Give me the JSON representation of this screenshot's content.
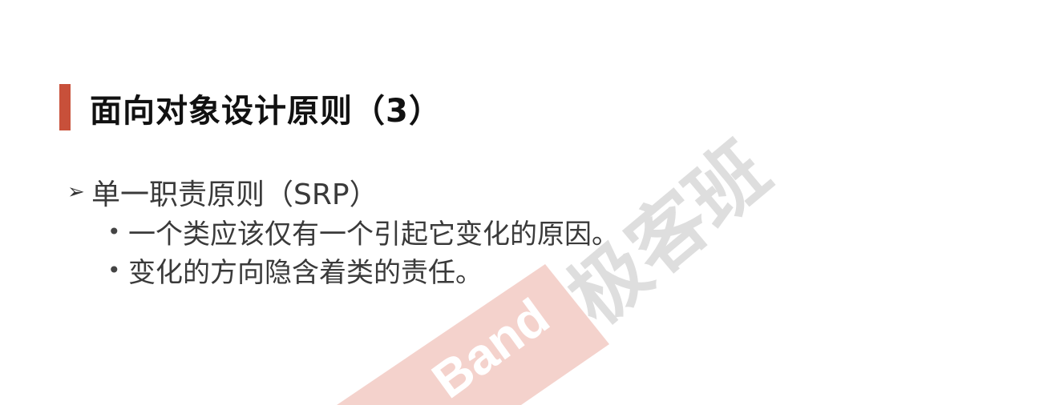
{
  "slide": {
    "title": "面向对象设计原则（3）",
    "heading": "单一职责原则（SRP）",
    "bullets": [
      "一个类应该仅有一个引起它变化的原因。",
      "变化的方向隐含着类的责任。"
    ],
    "watermark_text": "极客班",
    "watermark_banner_text": "Band"
  },
  "colors": {
    "accent": "#c8503a",
    "watermark_gray": "#d9d9d9",
    "watermark_red": "#f4d2cc"
  },
  "icons": {
    "heading_marker": "arrow-bullet-icon",
    "list_marker": "dot-bullet-icon"
  }
}
